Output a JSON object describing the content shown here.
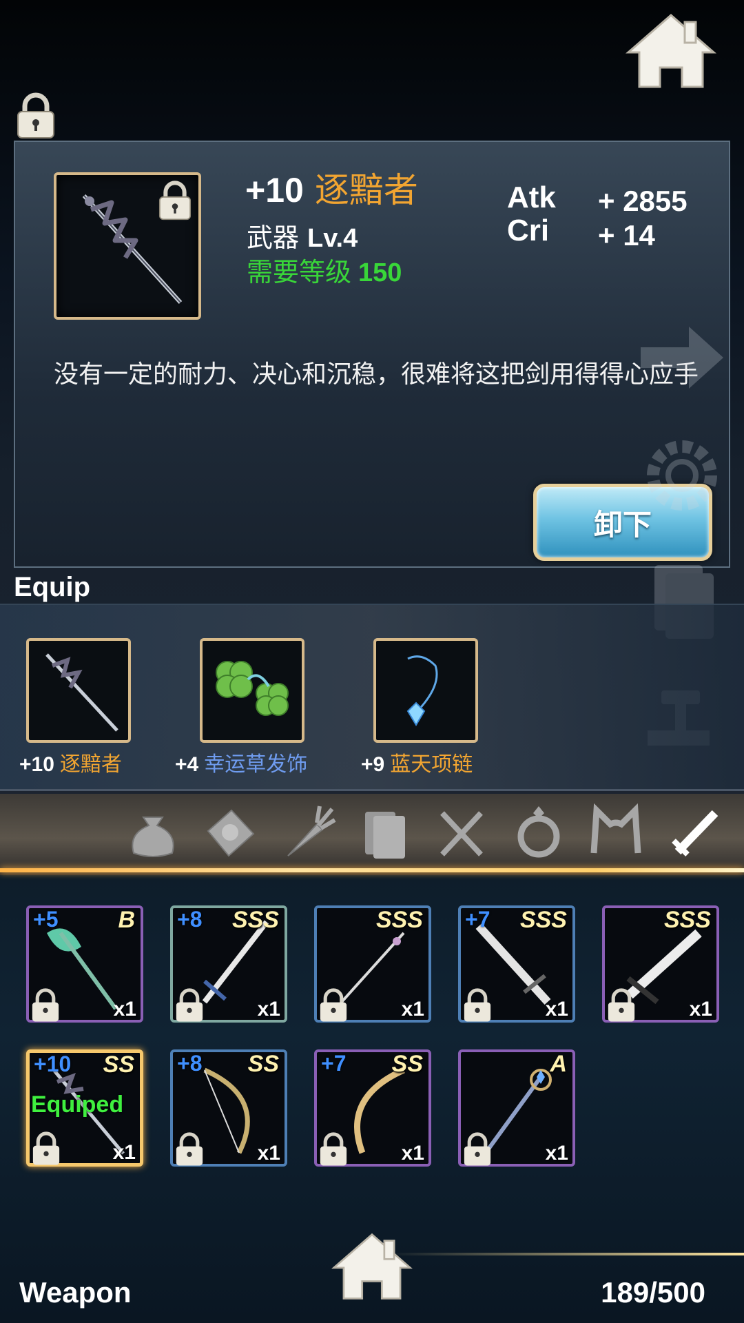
{
  "detail": {
    "enhance": "+10",
    "name": "逐黯者",
    "type": "武器",
    "level": "Lv.4",
    "req_label": "需要等级",
    "req_value": "150",
    "stats": [
      {
        "label": "Atk",
        "value": "+ 2855"
      },
      {
        "label": "Cri",
        "value": "+ 14"
      }
    ],
    "description": "没有一定的耐力、决心和沉稳，很难将这把剑用得得心应手",
    "unequip_label": "卸下"
  },
  "equip": {
    "label": "Equip",
    "slots": [
      {
        "enhance": "+10",
        "name": "逐黯者",
        "color": "#f2a531",
        "icon": "dark-sword-icon"
      },
      {
        "enhance": "+4",
        "name": "幸运草发饰",
        "color": "#6f9cf0",
        "icon": "clover-hairpin-icon"
      },
      {
        "enhance": "+9",
        "name": "蓝天项链",
        "color": "#f2a531",
        "icon": "blue-necklace-icon"
      }
    ]
  },
  "tabs": [
    {
      "icon": "bag-icon",
      "active": false
    },
    {
      "icon": "scroll-icon",
      "active": false
    },
    {
      "icon": "carrot-icon",
      "active": false
    },
    {
      "icon": "book-icon",
      "active": false
    },
    {
      "icon": "utensils-icon",
      "active": false
    },
    {
      "icon": "ring-icon",
      "active": false
    },
    {
      "icon": "cat-ears-icon",
      "active": false
    },
    {
      "icon": "sword-icon",
      "active": true
    }
  ],
  "inventory": [
    {
      "enhance": "+5",
      "grade": "B",
      "qty": "x1",
      "frame": "purple",
      "icon": "jade-axe-icon",
      "equipped": false
    },
    {
      "enhance": "+8",
      "grade": "SSS",
      "qty": "x1",
      "frame": "green",
      "icon": "silver-sword-icon",
      "equipped": false
    },
    {
      "enhance": "",
      "grade": "SSS",
      "qty": "x1",
      "frame": "blue",
      "icon": "thin-sword-icon",
      "equipped": false
    },
    {
      "enhance": "+7",
      "grade": "SSS",
      "qty": "x1",
      "frame": "blue",
      "icon": "broad-sword-icon",
      "equipped": false
    },
    {
      "enhance": "",
      "grade": "SSS",
      "qty": "x1",
      "frame": "purple",
      "icon": "great-sword-icon",
      "equipped": false
    },
    {
      "enhance": "+10",
      "grade": "SS",
      "qty": "x1",
      "frame": "equipped",
      "icon": "dark-sword-icon",
      "equipped": true,
      "equipped_label": "Equiped"
    },
    {
      "enhance": "+8",
      "grade": "SS",
      "qty": "x1",
      "frame": "blue",
      "icon": "vine-bow-icon",
      "equipped": false
    },
    {
      "enhance": "+7",
      "grade": "SS",
      "qty": "x1",
      "frame": "purple",
      "icon": "golden-bow-icon",
      "equipped": false
    },
    {
      "enhance": "",
      "grade": "A",
      "qty": "x1",
      "frame": "purple",
      "icon": "crystal-staff-icon",
      "equipped": false
    }
  ],
  "footer": {
    "title": "Weapon",
    "count": "189/500"
  }
}
